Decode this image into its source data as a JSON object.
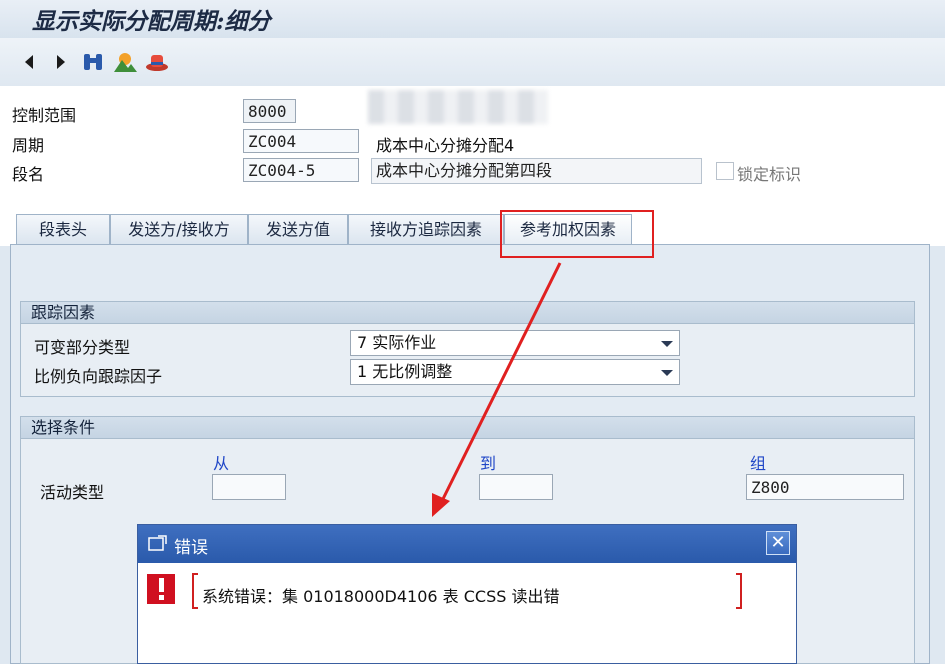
{
  "window": {
    "title": "显示实际分配周期:细分"
  },
  "header": {
    "control_area_label": "控制范围",
    "control_area_value": "8000",
    "cycle_label": "周期",
    "cycle_value": "ZC004",
    "cycle_text": "成本中心分摊分配4",
    "segment_label": "段名",
    "segment_value": "ZC004-5",
    "segment_text": "成本中心分摊分配第四段",
    "lock_label": "锁定标识"
  },
  "tabs": [
    {
      "label": "段表头"
    },
    {
      "label": "发送方/接收方"
    },
    {
      "label": "发送方值"
    },
    {
      "label": "接收方追踪因素"
    },
    {
      "label": "参考加权因素"
    }
  ],
  "tracking": {
    "title": "跟踪因素",
    "var_type_label": "可变部分类型",
    "var_type_value": "7 实际作业",
    "neg_factor_label": "比例负向跟踪因子",
    "neg_factor_value": "1 无比例调整"
  },
  "selection": {
    "title": "选择条件",
    "from_label": "从",
    "to_label": "到",
    "group_label": "组",
    "activity_type_label": "活动类型",
    "from_value": "",
    "to_value": "",
    "group_value": "Z800"
  },
  "dialog": {
    "title": "错误",
    "message": "系统错误：集 01018000D4106 表 CCSS 读出错",
    "close_symbol": "✕"
  },
  "colors": {
    "accent": "#2a5aab",
    "annotation": "#e02020",
    "error_icon": "#d01020"
  }
}
